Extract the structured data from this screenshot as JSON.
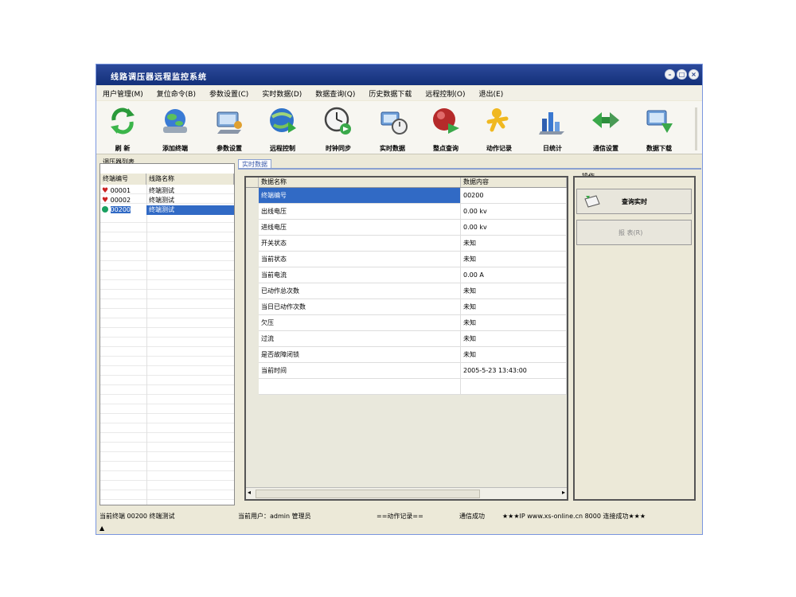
{
  "window": {
    "title": "线路调压器远程监控系统"
  },
  "menu": [
    "用户管理(M)",
    "复位命令(B)",
    "参数设置(C)",
    "实时数据(D)",
    "数据查询(Q)",
    "历史数据下载",
    "远程控制(O)",
    "退出(E)"
  ],
  "toolbar": [
    {
      "label": "刷 新",
      "icon": "refresh-icon"
    },
    {
      "label": "添加终端",
      "icon": "add-terminal-icon"
    },
    {
      "label": "参数设置",
      "icon": "settings-icon"
    },
    {
      "label": "远程控制",
      "icon": "remote-control-icon"
    },
    {
      "label": "时钟同步",
      "icon": "clock-sync-icon"
    },
    {
      "label": "实时数据",
      "icon": "realtime-data-icon"
    },
    {
      "label": "整点查询",
      "icon": "hourly-query-icon"
    },
    {
      "label": "动作记录",
      "icon": "action-record-icon"
    },
    {
      "label": "日统计",
      "icon": "daily-stats-icon"
    },
    {
      "label": "通信设置",
      "icon": "comm-settings-icon"
    },
    {
      "label": "数据下载",
      "icon": "data-download-icon"
    }
  ],
  "left_panel": {
    "title": "调压器列表",
    "columns": [
      "终端编号",
      "线路名称"
    ],
    "rows": [
      {
        "id": "00001",
        "name": "终端测试",
        "status_color": "#cc2222"
      },
      {
        "id": "00002",
        "name": "终端测试",
        "status_color": "#cc2222"
      },
      {
        "id": "00200",
        "name": "终端测试",
        "status_color": "#1aa060"
      }
    ]
  },
  "tab": "实时数据",
  "grid": {
    "columns": [
      "数据名称",
      "数据内容"
    ],
    "rows": [
      {
        "name": "终端编号",
        "value": "00200"
      },
      {
        "name": "出线电压",
        "value": "0.00 kv"
      },
      {
        "name": "进线电压",
        "value": "0.00 kv"
      },
      {
        "name": "开关状态",
        "value": "未知"
      },
      {
        "name": "当前状态",
        "value": "未知"
      },
      {
        "name": "当前电流",
        "value": "0.00 A"
      },
      {
        "name": "已动作总次数",
        "value": "未知"
      },
      {
        "name": "当日已动作次数",
        "value": "未知"
      },
      {
        "name": "欠压",
        "value": "未知"
      },
      {
        "name": "过流",
        "value": "未知"
      },
      {
        "name": "是否故障闭锁",
        "value": "未知"
      },
      {
        "name": "当前时间",
        "value": "2005-5-23 13:43:00"
      }
    ]
  },
  "operations": {
    "title": "操作",
    "query_button": "查询实时",
    "report_button": "报 表(R)"
  },
  "status": {
    "terminal": "当前终端   00200 终端测试",
    "user": "当前用户：admin 管理员",
    "action_record": "==动作记录==",
    "comm": "通信成功",
    "server": "★★★IP www.xs-online.cn 8000 连接成功★★★"
  }
}
